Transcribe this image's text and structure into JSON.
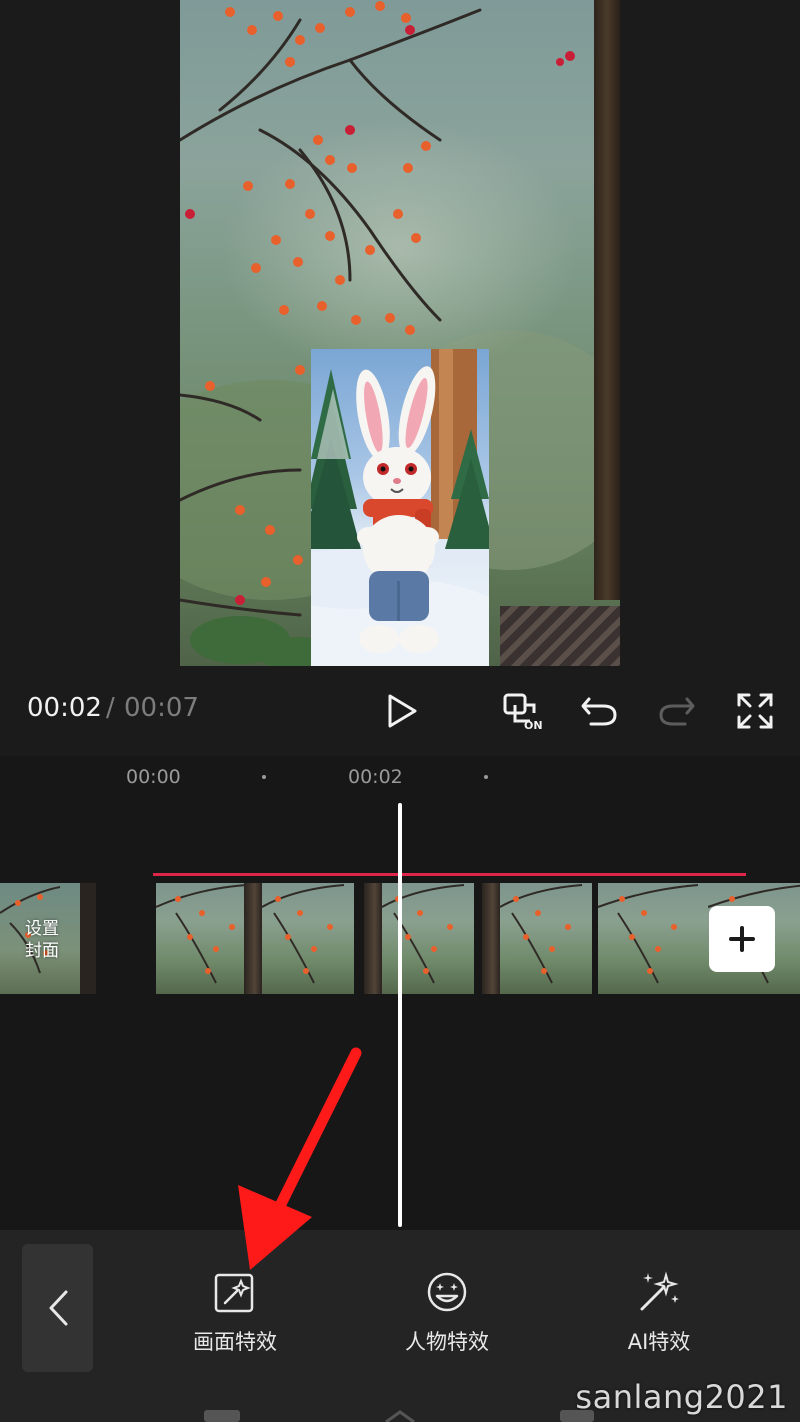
{
  "player": {
    "time_current": "00:02",
    "time_separator": "/",
    "time_total": "00:07",
    "controls": {
      "play": "play-icon",
      "loop": "loop-on-icon",
      "loop_badge": "ON",
      "undo": "undo-icon",
      "redo": "redo-icon",
      "fullscreen": "fullscreen-icon"
    }
  },
  "timeline": {
    "ticks": [
      "00:00",
      "00:02"
    ],
    "cover_label_line1": "设置",
    "cover_label_line2": "封面",
    "add_clip_icon": "plus-icon",
    "audio_line_color": "#e0254a"
  },
  "toolbar": {
    "back_icon": "chevron-left-icon",
    "items": [
      {
        "label": "画面特效",
        "icon": "scene-effect-icon"
      },
      {
        "label": "人物特效",
        "icon": "face-effect-icon"
      },
      {
        "label": "AI特效",
        "icon": "ai-magic-wand-icon"
      }
    ]
  },
  "annotation": {
    "arrow_color": "#ff1a1a"
  },
  "watermark": "sanlang2021"
}
